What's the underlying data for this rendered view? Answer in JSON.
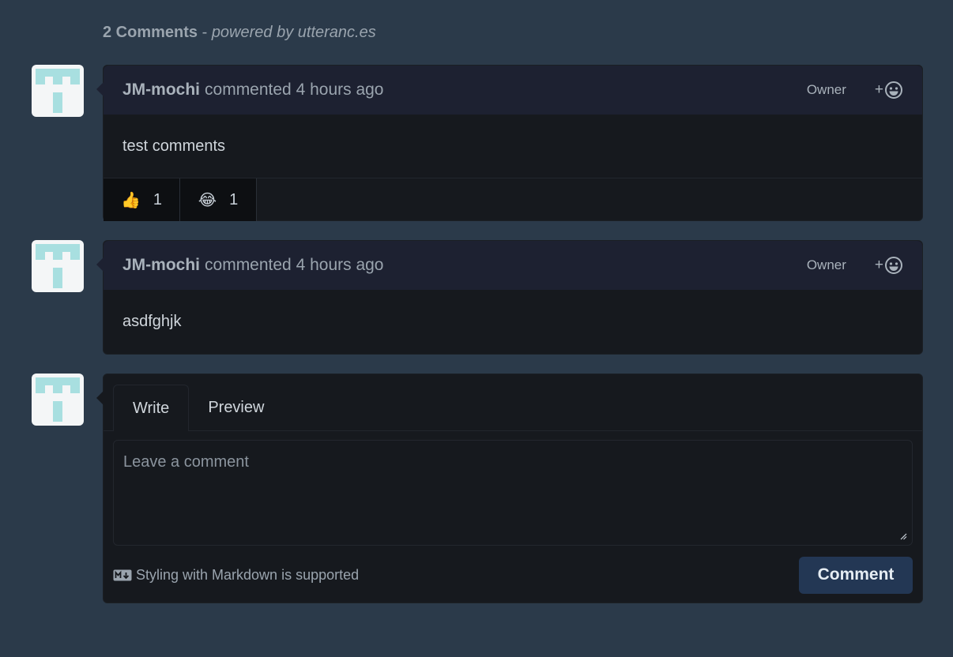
{
  "header": {
    "count_text": "2 Comments",
    "separator": " - ",
    "powered_text": "powered by utteranc.es"
  },
  "comments": [
    {
      "author": "JM-mochi",
      "meta": "commented 4 hours ago",
      "badge": "Owner",
      "add_reaction": "+",
      "body": "test comments",
      "reactions": [
        {
          "emoji": "👍",
          "count": "1"
        },
        {
          "emoji": "😂",
          "count": "1"
        }
      ]
    },
    {
      "author": "JM-mochi",
      "meta": "commented 4 hours ago",
      "badge": "Owner",
      "add_reaction": "+",
      "body": "asdfghjk"
    }
  ],
  "composer": {
    "tabs": [
      "Write",
      "Preview"
    ],
    "placeholder": "Leave a comment",
    "markdown_note": "Styling with Markdown is supported",
    "submit_label": "Comment"
  },
  "colors": {
    "page_bg": "#2b3a4a",
    "card_bg": "#16191e",
    "header_bg": "#1d2131",
    "button_bg": "#233754",
    "avatar_accent": "#a8dfe0"
  }
}
